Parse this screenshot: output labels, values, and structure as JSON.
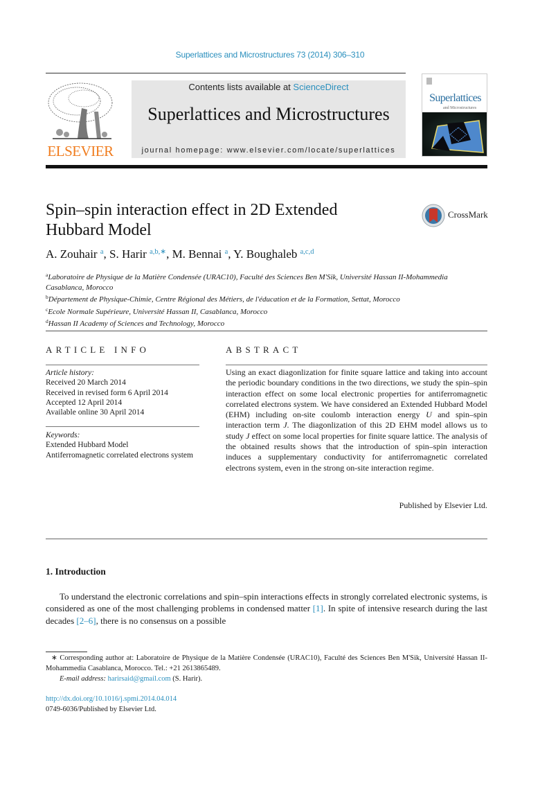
{
  "journal_ref": "Superlattices and Microstructures 73 (2014) 306–310",
  "header": {
    "publisher_logo": "ELSEVIER",
    "contents_prefix": "Contents lists available at ",
    "contents_link": "ScienceDirect",
    "journal_title": "Superlattices and Microstructures",
    "homepage": "journal homepage: www.elsevier.com/locate/superlattices",
    "cover_title": "Superlattices",
    "cover_subtitle": "and Microstructures"
  },
  "colors": {
    "link": "#2a8fbd",
    "elsevier_orange": "#f07c1e",
    "banner_bg": "#e6e6e6"
  },
  "article": {
    "title_line1": "Spin–spin interaction effect in 2D Extended",
    "title_line2": "Hubbard Model",
    "crossmark_label": "CrossMark",
    "authors": [
      {
        "name": "A. Zouhair",
        "sup": "a",
        "sep": ", "
      },
      {
        "name": "S. Harir",
        "sup": "a,b,∗",
        "sep": ", "
      },
      {
        "name": "M. Bennai",
        "sup": "a",
        "sep": ", "
      },
      {
        "name": "Y. Boughaleb",
        "sup": "a,c,d",
        "sep": ""
      }
    ],
    "affiliations": [
      {
        "sup": "a",
        "text": "Laboratoire de Physique de la Matière Condensée (URAC10), Faculté des Sciences Ben M'Sik, Université Hassan II-Mohammedia Casablanca, Morocco"
      },
      {
        "sup": "b",
        "text": "Département de Physique-Chimie, Centre Régional des Métiers, de l'éducation et de la Formation, Settat, Morocco"
      },
      {
        "sup": "c",
        "text": "Ecole Normale Supérieure, Université Hassan II, Casablanca, Morocco"
      },
      {
        "sup": "d",
        "text": "Hassan II Academy of Sciences and Technology, Morocco"
      }
    ]
  },
  "article_info": {
    "heading": "ARTICLE INFO",
    "history_label": "Article history:",
    "history": [
      "Received 20 March 2014",
      "Received in revised form 6 April 2014",
      "Accepted 12 April 2014",
      "Available online 30 April 2014"
    ],
    "keywords_label": "Keywords:",
    "keywords": [
      "Extended Hubbard Model",
      "Antiferromagnetic correlated electrons system"
    ]
  },
  "abstract": {
    "heading": "ABSTRACT",
    "part1": "Using an exact diagonlization for finite square lattice and taking into account the periodic boundary conditions in the two directions, we study the spin–spin interaction effect on some local electronic properties for antiferromagnetic correlated electrons system. We have considered an Extended Hubbard Model (EHM) including on-site coulomb interaction energy ",
    "sym_U": "U",
    "part2": " and spin–spin interaction term ",
    "sym_J1": "J",
    "part3": ". The diagonlization of this 2D EHM model allows us to study ",
    "sym_J2": "J",
    "part4": " effect on some local properties for finite square lattice. The analysis of the obtained results shows that the introduction of spin–spin interaction induces a supplementary conductivity for antiferromagnetic correlated electrons system, even in the strong on-site interaction regime.",
    "publisher": "Published by Elsevier Ltd."
  },
  "introduction": {
    "heading": "1. Introduction",
    "part1": "To understand the electronic correlations and spin–spin interactions effects in strongly correlated electronic systems, is considered as one of the most challenging problems in condensed matter ",
    "ref1": "[1]",
    "part2": ". In spite of intensive research during the last decades ",
    "ref2": "[2–6]",
    "part3": ", there is no consensus on a possible"
  },
  "footnotes": {
    "corresponding": "∗ Corresponding author at: Laboratoire de Physique de la Matière Condensée (URAC10), Faculté des Sciences Ben M'Sik, Université Hassan II-Mohammedia Casablanca, Morocco. Tel.: +21 2613865489.",
    "email_label": "E-mail address:",
    "email": "harirsaid@gmail.com",
    "email_suffix": " (S. Harir).",
    "doi": "http://dx.doi.org/10.1016/j.spmi.2014.04.014",
    "issn": "0749-6036/Published by Elsevier Ltd."
  }
}
